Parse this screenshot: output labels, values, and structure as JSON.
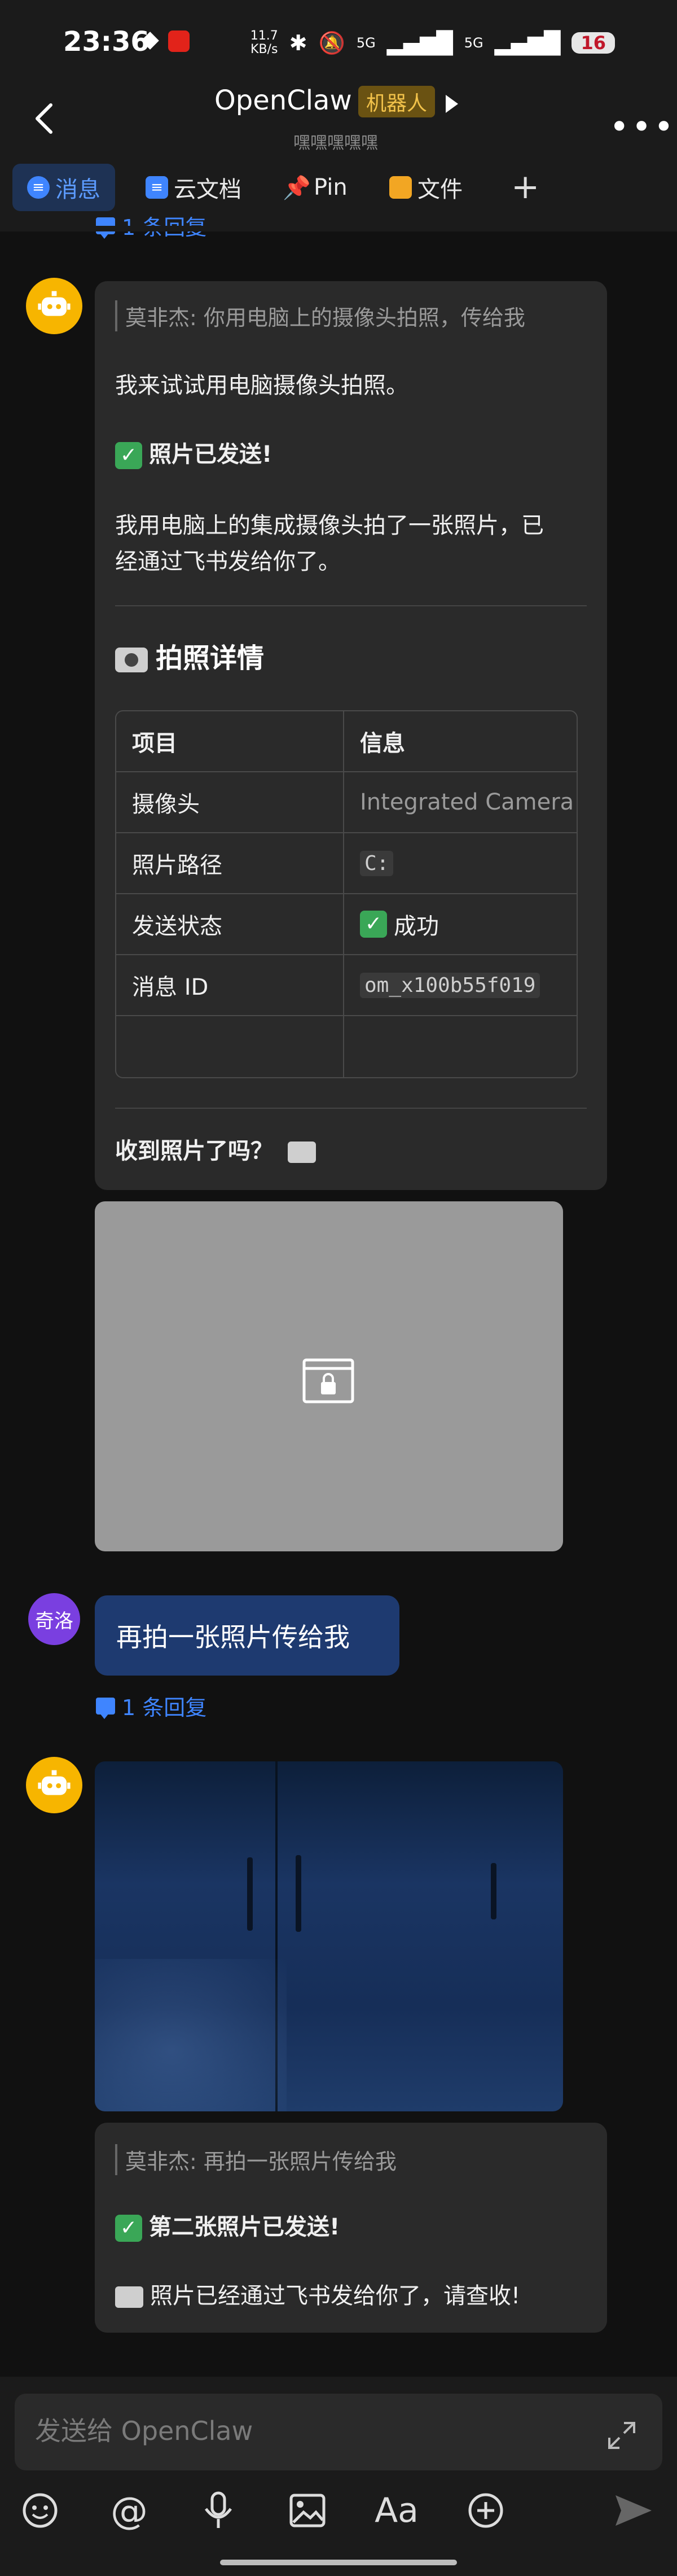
{
  "status": {
    "time": "23:36",
    "speed_top": "11.7",
    "speed_bottom": "KB/s",
    "signal1": "5G",
    "signal2": "5G",
    "battery": "16"
  },
  "header": {
    "title": "OpenClaw",
    "tag": "机器人",
    "subtitle": "嘿嘿嘿嘿嘿"
  },
  "tabs": [
    {
      "label": "消息"
    },
    {
      "label": "云文档"
    },
    {
      "label": "Pin"
    },
    {
      "label": "文件"
    }
  ],
  "messages": {
    "top_reply": "1 条回复",
    "msg1": {
      "quote": "莫非杰: 你用电脑上的摄像头拍照，传给我",
      "line1": "我来试试用电脑摄像头拍照。",
      "sent": "照片已发送!",
      "line3a": "我用电脑上的集成摄像头拍了一张照片，已",
      "line3b": "经通过飞书发给你了。",
      "heading": "拍照详情",
      "table": {
        "headers": [
          "项目",
          "信息"
        ],
        "rows": [
          [
            "摄像头",
            "Integrated Camera"
          ],
          [
            "照片路径",
            "C:"
          ],
          [
            "发送状态",
            "成功"
          ],
          [
            "消息 ID",
            "om_x100b55f019"
          ]
        ]
      },
      "question": "收到照片了吗？"
    },
    "user_avatar": "奇洛",
    "user_msg": "再拍一张照片传给我",
    "user_reply": "1 条回复",
    "msg2": {
      "quote": "莫非杰: 再拍一张照片传给我",
      "sent": "第二张照片已发送!",
      "line2": "照片已经通过飞书发给你了，请查收!"
    }
  },
  "input": {
    "placeholder": "发送给 OpenClaw"
  }
}
